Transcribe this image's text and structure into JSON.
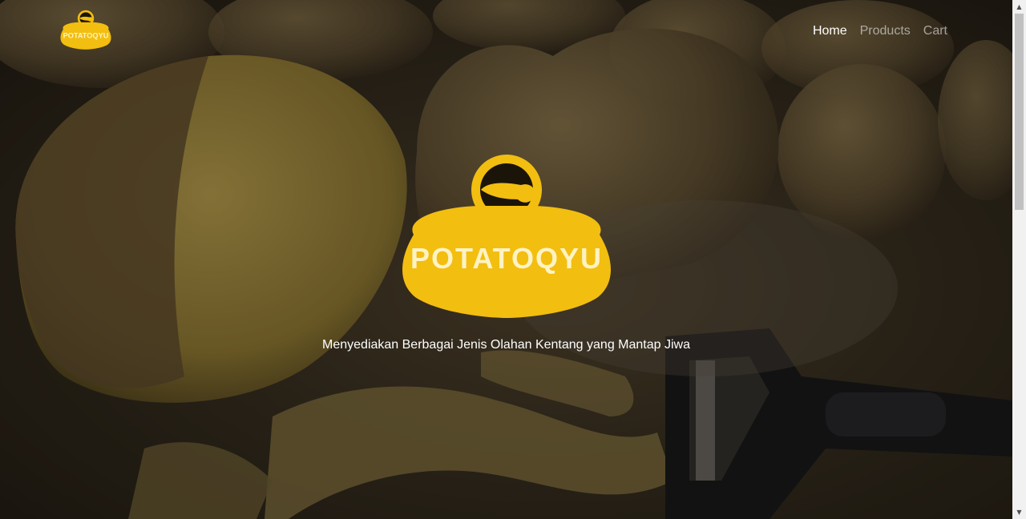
{
  "brand": {
    "name": "POTATOQYU",
    "color": "#F2BE10",
    "icon": "potato-chip-icon"
  },
  "nav": {
    "items": [
      {
        "label": "Home",
        "active": true
      },
      {
        "label": "Products",
        "active": false
      },
      {
        "label": "Cart",
        "active": false
      }
    ]
  },
  "hero": {
    "tagline": "Menyediakan Berbagai Jenis Olahan Kentang yang Mantap Jiwa",
    "background": "potatoes-and-peeler-photo"
  },
  "scrollbar": {
    "up_icon": "▲",
    "down_icon": "▼"
  }
}
